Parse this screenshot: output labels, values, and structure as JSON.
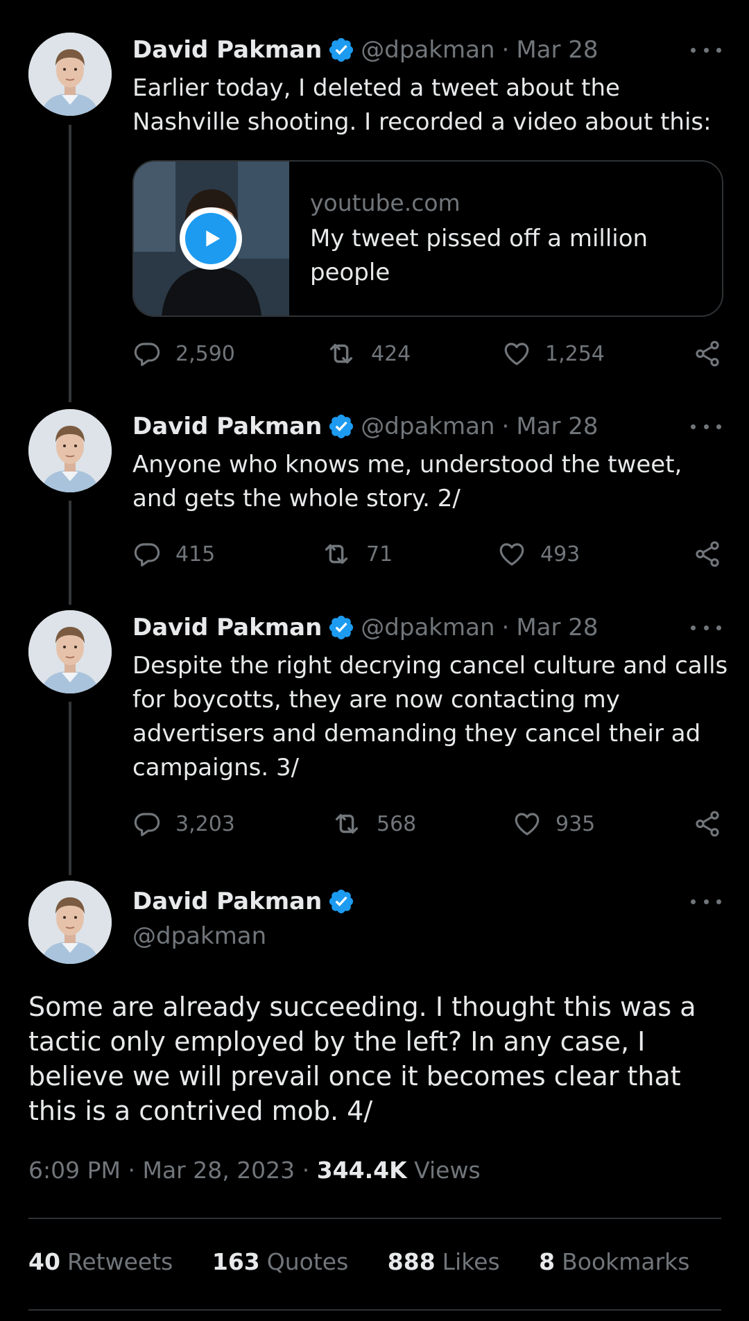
{
  "author": {
    "name": "David Pakman",
    "handle": "@dpakman"
  },
  "thread": [
    {
      "date": "Mar 28",
      "text": "Earlier today, I deleted a tweet about the Nashville shooting. I recorded a video about this:",
      "card": {
        "domain": "youtube.com",
        "title": "My tweet pissed off a million people"
      },
      "replies": "2,590",
      "retweets": "424",
      "likes": "1,254"
    },
    {
      "date": "Mar 28",
      "text": "Anyone who knows me, understood the tweet, and gets the whole story. 2/",
      "replies": "415",
      "retweets": "71",
      "likes": "493"
    },
    {
      "date": "Mar 28",
      "text": "Despite the right decrying cancel culture and calls for boycotts, they are now contacting my advertisers and demanding they cancel their ad campaigns. 3/",
      "replies": "3,203",
      "retweets": "568",
      "likes": "935"
    }
  ],
  "main_tweet": {
    "text": "Some are already succeeding. I thought this was a tactic only employed by the left? In any case, I believe we will prevail once it becomes clear that this is a contrived mob. 4/",
    "time": "6:09 PM",
    "date": "Mar 28, 2023",
    "views_count": "344.4K",
    "views_label": "Views",
    "separator": "·",
    "stats": {
      "retweets_count": "40",
      "retweets_label": "Retweets",
      "quotes_count": "163",
      "quotes_label": "Quotes",
      "likes_count": "888",
      "likes_label": "Likes",
      "bookmarks_count": "8",
      "bookmarks_label": "Bookmarks"
    }
  },
  "icons": {
    "verified": "verified-badge-icon",
    "reply": "reply-icon",
    "retweet": "retweet-icon",
    "like": "heart-icon",
    "share": "share-icon",
    "more": "more-icon",
    "play": "play-icon"
  },
  "colors": {
    "background": "#000000",
    "text": "#e7e9ea",
    "secondary": "#71767b",
    "accent": "#1d9bf0",
    "border": "#2f3336"
  }
}
